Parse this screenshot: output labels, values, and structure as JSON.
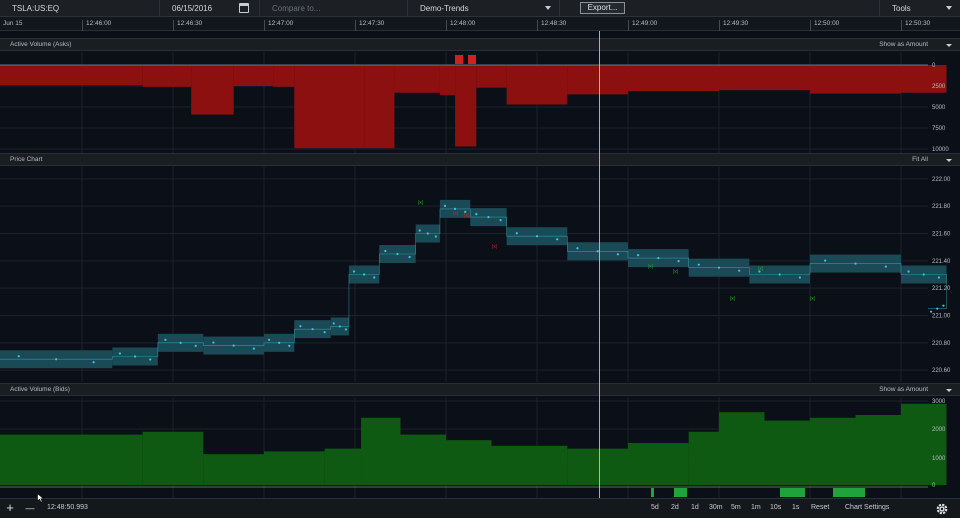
{
  "toolbar": {
    "symbol": "TSLA:US:EQ",
    "date": "06/15/2016",
    "compare_placeholder": "Compare to...",
    "preset": "Demo-Trends",
    "export_label": "Export...",
    "tools_label": "Tools"
  },
  "time_axis": {
    "labels": [
      "Jun 15",
      "12:46:00",
      "12:46:30",
      "12:47:00",
      "12:47:30",
      "12:48:00",
      "12:48:30",
      "12:49:00",
      "12:49:30",
      "12:50:00",
      "12:50:30"
    ]
  },
  "panels": {
    "asks": {
      "title": "Active Volume (Asks)",
      "mode": "Show as Amount",
      "ticks": [
        "0",
        "2500",
        "5000",
        "7500",
        "10000"
      ]
    },
    "price": {
      "title": "Price Chart",
      "mode": "Fit All",
      "ticks": [
        "222.00",
        "221.80",
        "221.60",
        "221.40",
        "221.20",
        "221.00",
        "220.80",
        "220.60"
      ]
    },
    "bids": {
      "title": "Active Volume (Bids)",
      "mode": "Show as Amount",
      "ticks": [
        "3000",
        "2000",
        "1000",
        "0"
      ]
    }
  },
  "bottom": {
    "zoom_in": "+",
    "zoom_out": "—",
    "current_time": "12:48:50.993",
    "ranges": [
      "5d",
      "2d",
      "1d",
      "30m",
      "5m",
      "1m",
      "10s",
      "1s",
      "Reset"
    ],
    "chart_settings": "Chart Settings"
  },
  "colors": {
    "ask_fill": "#8d1010",
    "bid_fill": "#0f5a12",
    "price_band": "#1b4a57",
    "price_point": "#3fc6db",
    "cursor_line": "#d8d46a",
    "accent_green": "#1fa33a",
    "accent_red": "#d02020"
  },
  "chart_data": [
    {
      "type": "area",
      "title": "Active Volume (Asks)",
      "yrange": [
        0,
        10000
      ],
      "x_time": [
        "12:45:45",
        "12:46:20",
        "12:46:36",
        "12:46:50",
        "12:47:03",
        "12:47:10",
        "12:47:33",
        "12:47:43",
        "12:47:58",
        "12:48:03",
        "12:48:10",
        "12:48:20",
        "12:48:40",
        "12:49:00",
        "12:49:30",
        "12:50:00",
        "12:50:30",
        "12:50:45"
      ],
      "values": [
        2400,
        2600,
        5900,
        2500,
        2600,
        9900,
        9900,
        3300,
        3600,
        9700,
        2700,
        4700,
        3500,
        3100,
        3000,
        3400,
        3300,
        3300
      ]
    },
    {
      "type": "line",
      "title": "Price Chart",
      "yrange": [
        220.55,
        222.05
      ],
      "x_time": [
        "12:45:45",
        "12:46:10",
        "12:46:25",
        "12:46:40",
        "12:47:00",
        "12:47:10",
        "12:47:22",
        "12:47:28",
        "12:47:38",
        "12:47:50",
        "12:47:58",
        "12:48:08",
        "12:48:20",
        "12:48:40",
        "12:49:00",
        "12:49:20",
        "12:49:40",
        "12:50:00",
        "12:50:30",
        "12:50:45"
      ],
      "values": [
        220.68,
        220.7,
        220.8,
        220.78,
        220.8,
        220.9,
        220.92,
        221.3,
        221.45,
        221.6,
        221.78,
        221.72,
        221.58,
        221.47,
        221.42,
        221.35,
        221.3,
        221.38,
        221.3,
        221.05
      ]
    },
    {
      "type": "area",
      "title": "Active Volume (Bids)",
      "yrange": [
        0,
        3000
      ],
      "x_time": [
        "12:45:45",
        "12:46:20",
        "12:46:40",
        "12:47:00",
        "12:47:20",
        "12:47:32",
        "12:47:45",
        "12:48:00",
        "12:48:15",
        "12:48:40",
        "12:49:00",
        "12:49:20",
        "12:49:30",
        "12:49:45",
        "12:50:00",
        "12:50:15",
        "12:50:30",
        "12:50:45"
      ],
      "values": [
        1800,
        1900,
        1100,
        1200,
        1300,
        2400,
        1800,
        1600,
        1400,
        1300,
        1500,
        1900,
        2600,
        2300,
        2400,
        2500,
        2900,
        1800
      ]
    }
  ]
}
